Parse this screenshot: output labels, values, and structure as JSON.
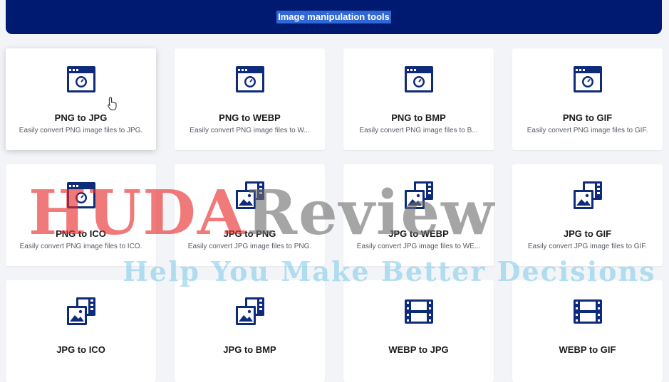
{
  "header": {
    "title": "Image manipulation tools"
  },
  "colors": {
    "header_bg": "#001a72",
    "icon": "#0d2b7a",
    "highlight": "#2f67d6"
  },
  "tools": [
    {
      "title": "PNG to JPG",
      "desc": "Easily convert PNG image files to JPG.",
      "icon": "image-window-icon"
    },
    {
      "title": "PNG to WEBP",
      "desc": "Easily convert PNG image files to W...",
      "icon": "image-window-icon"
    },
    {
      "title": "PNG to BMP",
      "desc": "Easily convert PNG image files to B...",
      "icon": "image-window-icon"
    },
    {
      "title": "PNG to GIF",
      "desc": "Easily convert PNG image files to GIF.",
      "icon": "image-window-icon"
    },
    {
      "title": "PNG to ICO",
      "desc": "Easily convert PNG image files to ICO.",
      "icon": "image-window-icon"
    },
    {
      "title": "JPG to PNG",
      "desc": "Easily convert JPG image files to PNG.",
      "icon": "photo-gallery-icon"
    },
    {
      "title": "JPG to WEBP",
      "desc": "Easily convert JPG image files to WE...",
      "icon": "photo-gallery-icon"
    },
    {
      "title": "JPG to GIF",
      "desc": "Easily convert JPG image files to GIF.",
      "icon": "photo-gallery-icon"
    },
    {
      "title": "JPG to ICO",
      "desc": "",
      "icon": "photo-gallery-icon"
    },
    {
      "title": "JPG to BMP",
      "desc": "",
      "icon": "photo-gallery-icon"
    },
    {
      "title": "WEBP to JPG",
      "desc": "",
      "icon": "film-strip-icon"
    },
    {
      "title": "WEBP to GIF",
      "desc": "",
      "icon": "film-strip-icon"
    }
  ],
  "watermark": {
    "brand_part1": "HUDA",
    "brand_part2": "Review",
    "tagline": "Help You Make Better Decisions"
  }
}
